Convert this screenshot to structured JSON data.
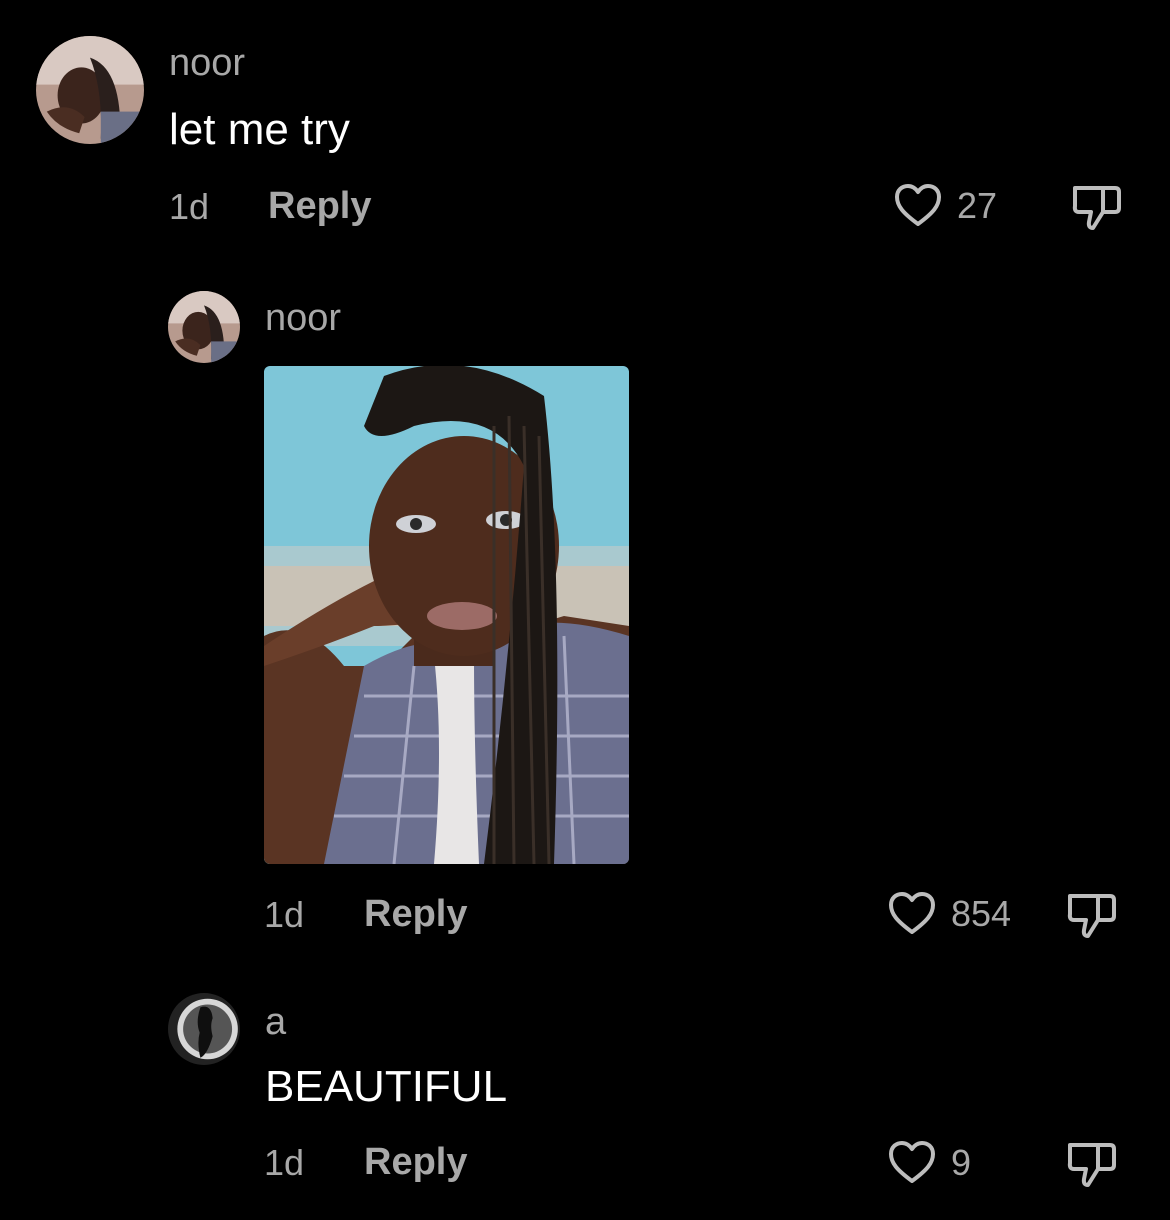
{
  "comments": [
    {
      "username": "noor",
      "text": "let me try",
      "time": "1d",
      "reply_label": "Reply",
      "likes": "27",
      "avatar_icon": "user-avatar-photo"
    },
    {
      "username": "noor",
      "time": "1d",
      "reply_label": "Reply",
      "likes": "854",
      "avatar_icon": "user-avatar-photo",
      "attachment": "selfie-photo"
    },
    {
      "username": "a",
      "text": "BEAUTIFUL",
      "time": "1d",
      "reply_label": "Reply",
      "likes": "9",
      "avatar_icon": "user-avatar-photo"
    }
  ],
  "icons": {
    "like": "heart-outline-icon",
    "dislike": "thumbs-down-icon"
  },
  "colors": {
    "background": "#000000",
    "primary_text": "#ffffff",
    "secondary_text": "#a8a8a8"
  }
}
